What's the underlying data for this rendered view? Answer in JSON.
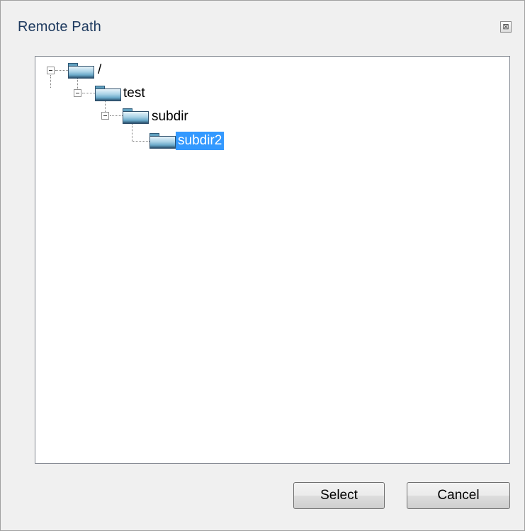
{
  "dialog": {
    "title": "Remote Path",
    "close_glyph": "⊠"
  },
  "tree": {
    "nodes": [
      {
        "label": "/",
        "expanded": true,
        "icon": "folder-icon"
      },
      {
        "label": "test",
        "expanded": true,
        "icon": "folder-icon"
      },
      {
        "label": "subdir",
        "expanded": true,
        "icon": "folder-icon"
      },
      {
        "label": "subdir2",
        "selected": true,
        "icon": "folder-icon"
      }
    ]
  },
  "buttons": {
    "select_label": "Select",
    "cancel_label": "Cancel"
  },
  "colors": {
    "selection": "#3399ff",
    "title_text": "#1e3a5f",
    "background": "#f0f0f0"
  }
}
